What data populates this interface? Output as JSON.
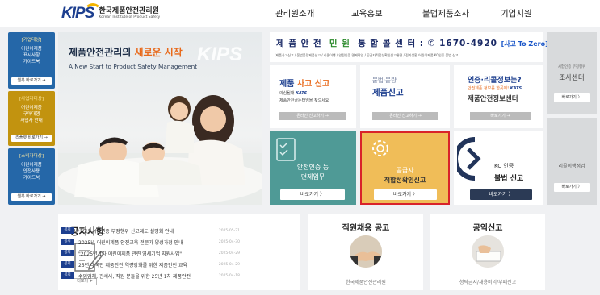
{
  "header": {
    "logo_text": "KIPS",
    "org_name": "한국제품안전관리원",
    "org_name_en": "Korean Institute of Product Safety",
    "nav": [
      "관리원소개",
      "교육홍보",
      "불법제품조사",
      "기업지원"
    ]
  },
  "left_banners": [
    {
      "tag": "[기업대상]",
      "lines": [
        "어린이제품",
        "표시사항",
        "가이드북"
      ],
      "button": "웹북 바로가기 →",
      "color": "#2567a8"
    },
    {
      "tag": "[사업자대상]",
      "lines": [
        "어린이제품",
        "구매대행",
        "사업자 안내"
      ],
      "button": "리플렛 바로가기 →",
      "color": "#c2930f"
    },
    {
      "tag": "[소비자대상]",
      "lines": [
        "어린이제품",
        "안전사용",
        "가이드북"
      ],
      "button": "웹북 바로가기 →",
      "color": "#2567a8"
    }
  ],
  "hero": {
    "title_a": "제품안전관리의",
    "title_b": "새로운 시작",
    "subtitle": "A New Start to Product Safety Management",
    "brand": "KIPS"
  },
  "hotline": {
    "label_a": "제 품 안 전",
    "label_b": "민 원",
    "label_c": "통 합 콜 센 터 :",
    "number": "1670-4920",
    "slogan": "[사고 To Zero]",
    "sub": "[제품사고신고 / 불법불량제품신고 / 리콜이행 / 안전인증 면제확인 / 공급자적합성확인신고관련 / 전기생활 어린이제품 KC인증 불법 신고]"
  },
  "cards": {
    "accident": {
      "title_a": "제품",
      "title_b": "사고 신고",
      "line1": "의심될때",
      "line2": "제품안전골든타임을 찾으세요",
      "button": "온라인 신고하기 →"
    },
    "defect": {
      "title_a": "불법·불량",
      "title_b": "제품신고",
      "button": "온라인 신고하기 →"
    },
    "info": {
      "title_a": "인증·리콜정보는?",
      "title_b": "제품안전정보센터",
      "script": "안전제품 정보를 한곳에!",
      "button": "바로가기 →"
    },
    "exempt": {
      "title_a": "안전인증 등",
      "title_b": "면제업무",
      "button": "바로가기 〉"
    },
    "supplier": {
      "title_a": "공급자",
      "title_b": "적합성확인신고",
      "button": "바로가기 〉"
    },
    "kc": {
      "title_a": "KC 인증",
      "title_b": "불법 신고",
      "button": "바로가기 〉"
    }
  },
  "right_side": [
    {
      "small": "시험인증 부정행위",
      "big": "조사센터",
      "button": "바로가기 〉"
    },
    {
      "small": "",
      "big": "리콜이행점검",
      "button": "바로가기 〉"
    }
  ],
  "notice": {
    "title": "공지사항",
    "more": "더보기 +",
    "tag": "공지",
    "items": [
      {
        "title": "'25년 시험인증 부정행위 신고제도 설명회 안내",
        "date": "2025-05-21"
      },
      {
        "title": "2025년 어린이제품 안전교육 전문가 양성과정 안내",
        "date": "2025-04-30"
      },
      {
        "title": "\"2025년 1차 어린이제품 관련 영세기업 지원사업\"",
        "date": "2025-04-29"
      },
      {
        "title": "25년 대국민 제품안전 역량강화를 위한 제품안전 교육",
        "date": "2025-04-29"
      },
      {
        "title": "수입업체, 관세사, 직원 분들을 위한 25년 1차 제품안전",
        "date": "2025-04-18"
      }
    ]
  },
  "recruit": {
    "title": "직원채용 공고",
    "caption": "한국제품안전관리원"
  },
  "public_notice": {
    "title": "공익신고",
    "caption": "청탁금지/채용비리/부패신고"
  },
  "colors": {
    "navy": "#1d3f8f",
    "gold": "#f3b400",
    "teal": "#4f9a96",
    "amber": "#f0bd58",
    "highlight": "#d9232a"
  }
}
